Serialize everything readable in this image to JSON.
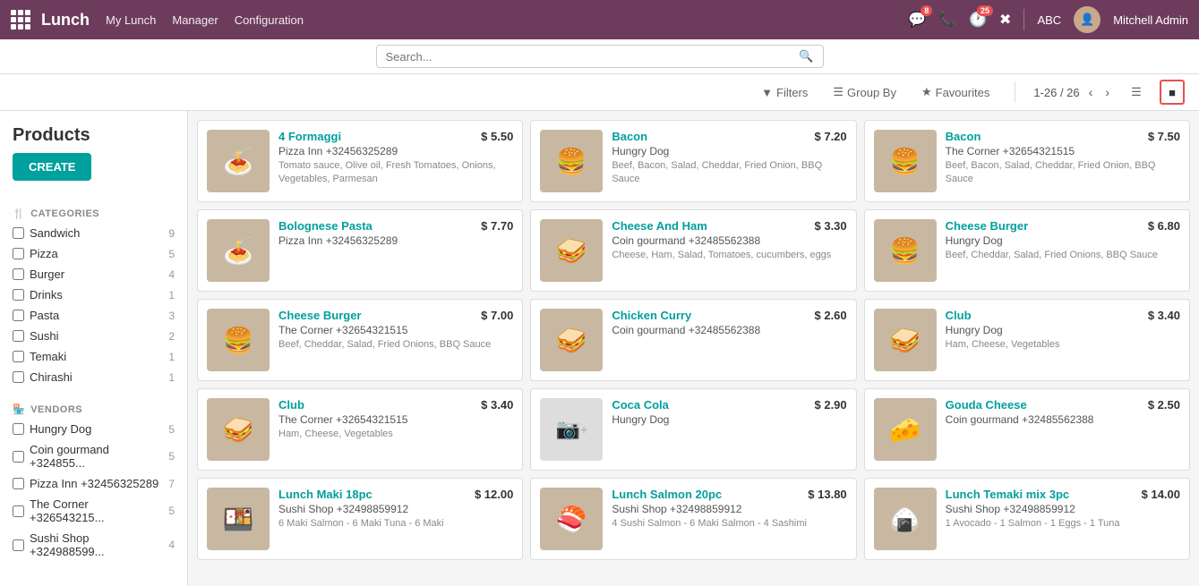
{
  "app": {
    "logo": "Lunch",
    "nav": [
      "My Lunch",
      "Manager",
      "Configuration"
    ]
  },
  "topnav_icons": [
    {
      "name": "chat-icon",
      "symbol": "💬",
      "badge": "8"
    },
    {
      "name": "phone-icon",
      "symbol": "📞",
      "badge": null
    },
    {
      "name": "clock-icon",
      "symbol": "🕐",
      "badge": "25"
    },
    {
      "name": "tools-icon",
      "symbol": "✖",
      "badge": null
    }
  ],
  "topnav_user": "Mitchell Admin",
  "topnav_abc": "ABC",
  "search": {
    "placeholder": "Search..."
  },
  "toolbar": {
    "filters_label": "Filters",
    "groupby_label": "Group By",
    "favourites_label": "Favourites",
    "pagination": "1-26 / 26",
    "create_label": "CREATE"
  },
  "sidebar": {
    "categories_title": "CATEGORIES",
    "categories": [
      {
        "label": "Sandwich",
        "count": 9
      },
      {
        "label": "Pizza",
        "count": 5
      },
      {
        "label": "Burger",
        "count": 4
      },
      {
        "label": "Drinks",
        "count": 1
      },
      {
        "label": "Pasta",
        "count": 3
      },
      {
        "label": "Sushi",
        "count": 2
      },
      {
        "label": "Temaki",
        "count": 1
      },
      {
        "label": "Chirashi",
        "count": 1
      }
    ],
    "vendors_title": "VENDORS",
    "vendors": [
      {
        "label": "Hungry Dog",
        "count": 5
      },
      {
        "label": "Coin gourmand +324855...",
        "count": 5
      },
      {
        "label": "Pizza Inn +32456325289",
        "count": 7
      },
      {
        "label": "The Corner +326543215...",
        "count": 5
      },
      {
        "label": "Sushi Shop +324988599...",
        "count": 4
      }
    ]
  },
  "page_title": "Products",
  "products": [
    {
      "name": "4 Formaggi",
      "price": "$ 5.50",
      "vendor": "Pizza Inn +32456325289",
      "desc": "Tomato sauce, Olive oil, Fresh Tomatoes, Onions, Vegetables, Parmesan",
      "emoji": "🍝"
    },
    {
      "name": "Bacon",
      "price": "$ 7.20",
      "vendor": "Hungry Dog",
      "desc": "Beef, Bacon, Salad, Cheddar, Fried Onion, BBQ Sauce",
      "emoji": "🍔"
    },
    {
      "name": "Bacon",
      "price": "$ 7.50",
      "vendor": "The Corner +32654321515",
      "desc": "Beef, Bacon, Salad, Cheddar, Fried Onion, BBQ Sauce",
      "emoji": "🍔"
    },
    {
      "name": "Bolognese Pasta",
      "price": "$ 7.70",
      "vendor": "Pizza Inn +32456325289",
      "desc": "",
      "emoji": "🍝"
    },
    {
      "name": "Cheese And Ham",
      "price": "$ 3.30",
      "vendor": "Coin gourmand +32485562388",
      "desc": "Cheese, Ham, Salad, Tomatoes, cucumbers, eggs",
      "emoji": "🥪"
    },
    {
      "name": "Cheese Burger",
      "price": "$ 6.80",
      "vendor": "Hungry Dog",
      "desc": "Beef, Cheddar, Salad, Fried Onions, BBQ Sauce",
      "emoji": "🍔"
    },
    {
      "name": "Cheese Burger",
      "price": "$ 7.00",
      "vendor": "The Corner +32654321515",
      "desc": "Beef, Cheddar, Salad, Fried Onions, BBQ Sauce",
      "emoji": "🍔"
    },
    {
      "name": "Chicken Curry",
      "price": "$ 2.60",
      "vendor": "Coin gourmand +32485562388",
      "desc": "",
      "emoji": "🥪"
    },
    {
      "name": "Club",
      "price": "$ 3.40",
      "vendor": "Hungry Dog",
      "desc": "Ham, Cheese, Vegetables",
      "emoji": "🥪"
    },
    {
      "name": "Club",
      "price": "$ 3.40",
      "vendor": "The Corner +32654321515",
      "desc": "Ham, Cheese, Vegetables",
      "emoji": "🥪"
    },
    {
      "name": "Coca Cola",
      "price": "$ 2.90",
      "vendor": "Hungry Dog",
      "desc": "",
      "emoji": "📷",
      "no_image": true
    },
    {
      "name": "Gouda Cheese",
      "price": "$ 2.50",
      "vendor": "Coin gourmand +32485562388",
      "desc": "",
      "emoji": "🧀"
    },
    {
      "name": "Lunch Maki 18pc",
      "price": "$ 12.00",
      "vendor": "Sushi Shop +32498859912",
      "desc": "6 Maki Salmon - 6 Maki Tuna - 6 Maki",
      "emoji": "🍱"
    },
    {
      "name": "Lunch Salmon 20pc",
      "price": "$ 13.80",
      "vendor": "Sushi Shop +32498859912",
      "desc": "4 Sushi Salmon - 6 Maki Salmon - 4 Sashimi",
      "emoji": "🍣"
    },
    {
      "name": "Lunch Temaki mix 3pc",
      "price": "$ 14.00",
      "vendor": "Sushi Shop +32498859912",
      "desc": "1 Avocado - 1 Salmon - 1 Eggs - 1 Tuna",
      "emoji": "🍙"
    }
  ]
}
